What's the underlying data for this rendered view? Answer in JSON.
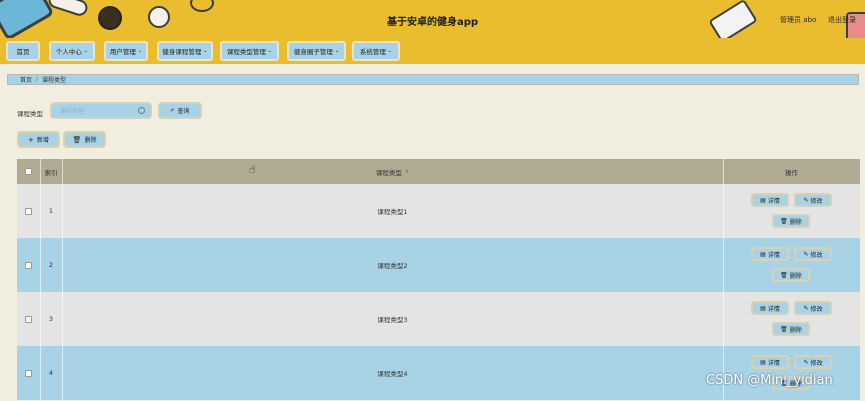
{
  "header": {
    "title": "基于安卓的健身app",
    "user_label": "管理员 abo",
    "logout_label": "退出登录"
  },
  "nav": {
    "items": [
      {
        "label": "首页",
        "has_dropdown": false
      },
      {
        "label": "个人中心",
        "has_dropdown": true
      },
      {
        "label": "用户管理",
        "has_dropdown": true
      },
      {
        "label": "健身课程管理",
        "has_dropdown": true
      },
      {
        "label": "课程类型管理",
        "has_dropdown": true
      },
      {
        "label": "健身圈子管理",
        "has_dropdown": true
      },
      {
        "label": "系统管理",
        "has_dropdown": true
      }
    ]
  },
  "breadcrumb": {
    "home": "首页",
    "separator": "/",
    "current": "课程类型"
  },
  "search": {
    "label": "课程类型",
    "placeholder": "课程类型",
    "search_button": "查询",
    "search_icon": "search-icon"
  },
  "toolbar": {
    "add_label": "新增",
    "delete_label": "删除"
  },
  "table": {
    "columns": {
      "index": "索引",
      "type": "课程类型",
      "actions": "操作"
    },
    "rows": [
      {
        "index": "1",
        "type": "课程类型1"
      },
      {
        "index": "2",
        "type": "课程类型2"
      },
      {
        "index": "3",
        "type": "课程类型3"
      },
      {
        "index": "4",
        "type": "课程类型4"
      }
    ],
    "row_actions": {
      "detail": "详情",
      "edit": "修改",
      "delete": "删除"
    }
  },
  "watermark": "CSDN @Mini_yidian",
  "colors": {
    "header_bg": "#e9bd2d",
    "accent_blue": "#a8d2e6",
    "table_header": "#b1ab93",
    "page_bg": "#f2eedf"
  }
}
